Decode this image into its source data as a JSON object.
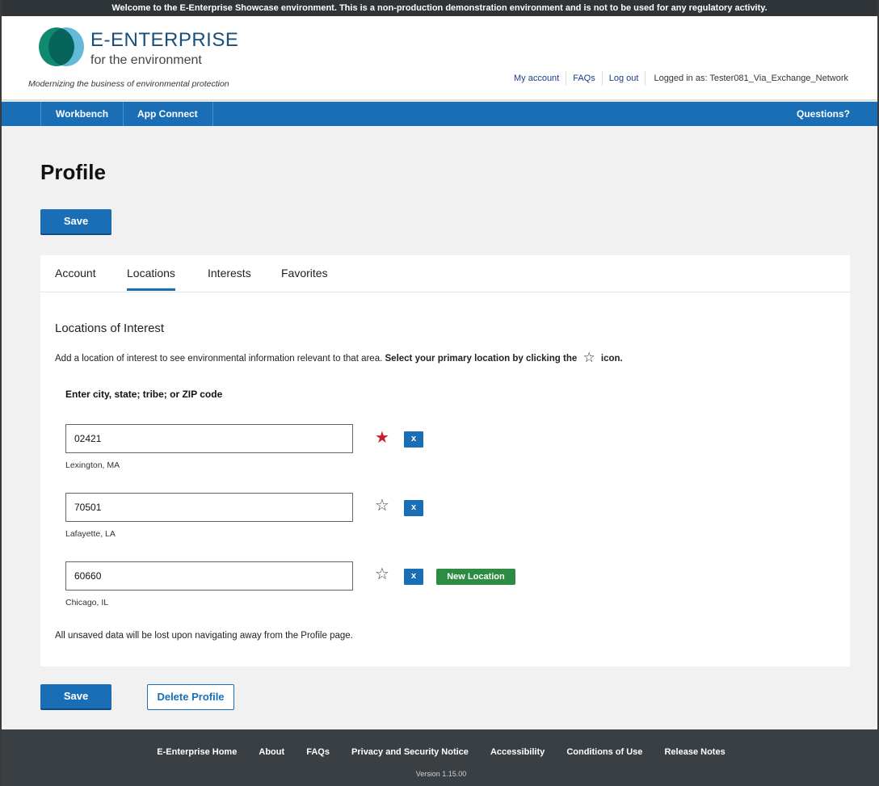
{
  "banner": {
    "text": "Welcome to the E-Enterprise Showcase environment. This is a non-production demonstration environment and is not to be used for any regulatory activity."
  },
  "header": {
    "brand_title": "E-ENTERPRISE",
    "brand_subtitle": "for the environment",
    "tagline": "Modernizing the business of environmental protection",
    "links": [
      "My account",
      "FAQs",
      "Log out"
    ],
    "logged_in": "Logged in as: Tester081_Via_Exchange_Network"
  },
  "nav": {
    "items": [
      "Workbench",
      "App Connect"
    ],
    "questions": "Questions?"
  },
  "page": {
    "title": "Profile",
    "save_label": "Save",
    "delete_label": "Delete Profile"
  },
  "tabs": [
    {
      "label": "Account",
      "active": false
    },
    {
      "label": "Locations",
      "active": true
    },
    {
      "label": "Interests",
      "active": false
    },
    {
      "label": "Favorites",
      "active": false
    }
  ],
  "locations": {
    "section_title": "Locations of Interest",
    "instructions_prefix": "Add a location of interest to see environmental information relevant to that area.",
    "instructions_bold": "Select your primary location by clicking the",
    "instructions_suffix": "icon.",
    "field_label": "Enter city, state; tribe; or ZIP code",
    "entries": [
      {
        "value": "02421",
        "name": "Lexington, MA",
        "primary": true,
        "remove_label": "x",
        "badge": ""
      },
      {
        "value": "70501",
        "name": "Lafayette, LA",
        "primary": false,
        "remove_label": "x",
        "badge": ""
      },
      {
        "value": "60660",
        "name": "Chicago, IL",
        "primary": false,
        "remove_label": "x",
        "badge": "New Location"
      }
    ],
    "warning": "All unsaved data will be lost upon navigating away from the Profile page."
  },
  "footer": {
    "links": [
      "E-Enterprise Home",
      "About",
      "FAQs",
      "Privacy and Security Notice",
      "Accessibility",
      "Conditions of Use",
      "Release Notes"
    ],
    "version": "Version 1.15.00"
  },
  "colors": {
    "primary_blue": "#1a6eb6",
    "star_primary": "#c8202a",
    "new_badge": "#2e8b44",
    "footer_bg": "#3a3f43"
  }
}
